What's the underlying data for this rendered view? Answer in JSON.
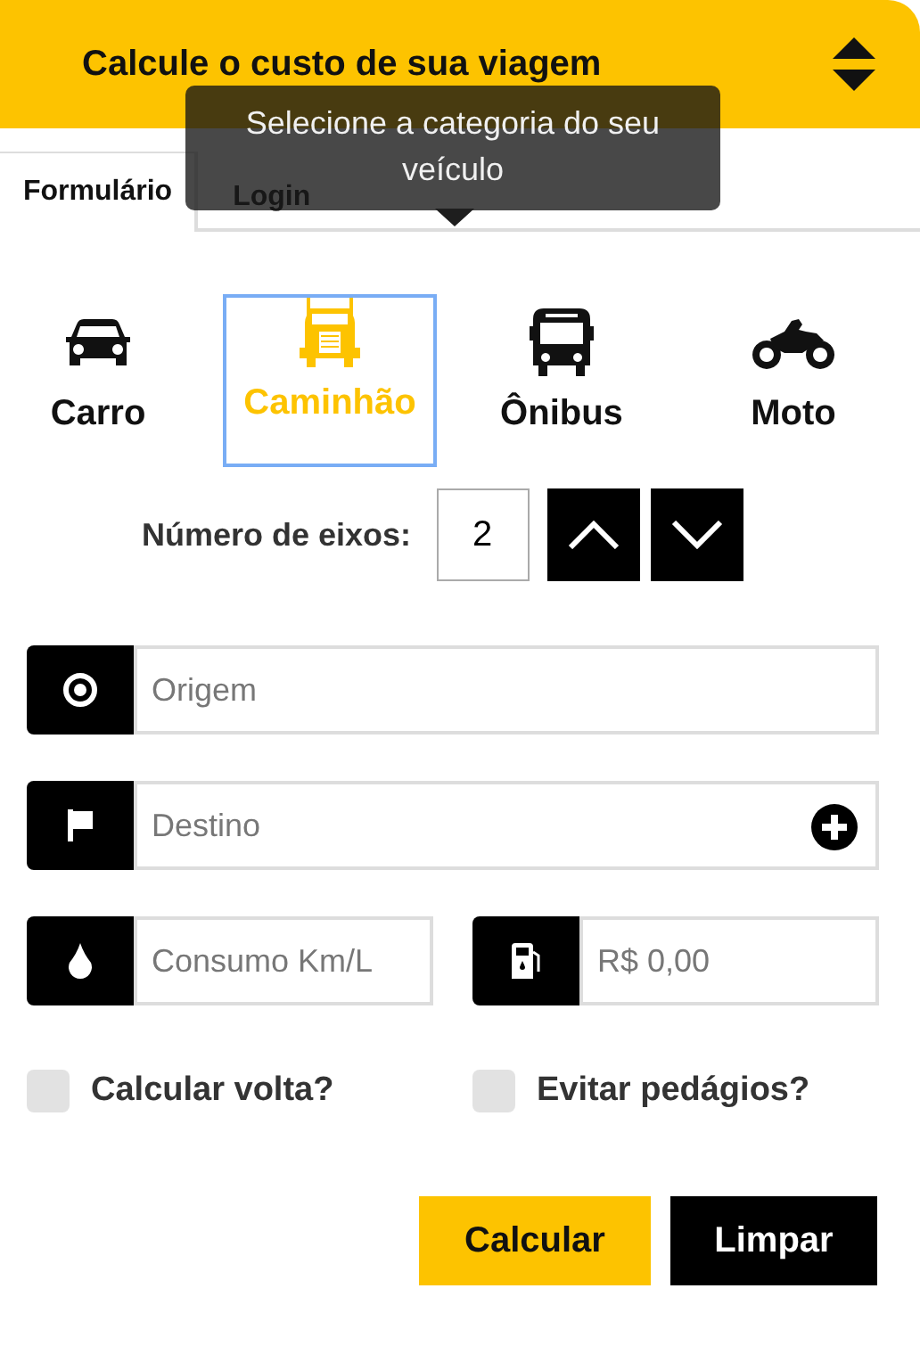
{
  "header": {
    "title": "Calcule o custo de sua viagem"
  },
  "tooltip": {
    "text": "Selecione a categoria do seu veículo"
  },
  "tabs": [
    {
      "label": "Formulário",
      "selected": true
    },
    {
      "label": "Login",
      "selected": false
    }
  ],
  "vehicles": [
    {
      "kind": "car",
      "label": "Carro",
      "selected": false
    },
    {
      "kind": "truck",
      "label": "Caminhão",
      "selected": true
    },
    {
      "kind": "bus",
      "label": "Ônibus",
      "selected": false
    },
    {
      "kind": "moto",
      "label": "Moto",
      "selected": false
    }
  ],
  "axles": {
    "label": "Número de eixos:",
    "value": "2"
  },
  "fields": [
    {
      "kind": "origin",
      "placeholder": "Origem"
    },
    {
      "kind": "destination",
      "placeholder": "Destino"
    },
    {
      "kind": "consumption",
      "placeholder": "Consumo Km/L"
    },
    {
      "kind": "price",
      "placeholder": "R$ 0,00"
    }
  ],
  "options": [
    {
      "label": "Calcular volta?",
      "checked": false
    },
    {
      "label": "Evitar pedágios?",
      "checked": false
    }
  ],
  "buttons": [
    {
      "kind": "primary",
      "label": "Calcular"
    },
    {
      "kind": "secondary",
      "label": "Limpar"
    }
  ]
}
